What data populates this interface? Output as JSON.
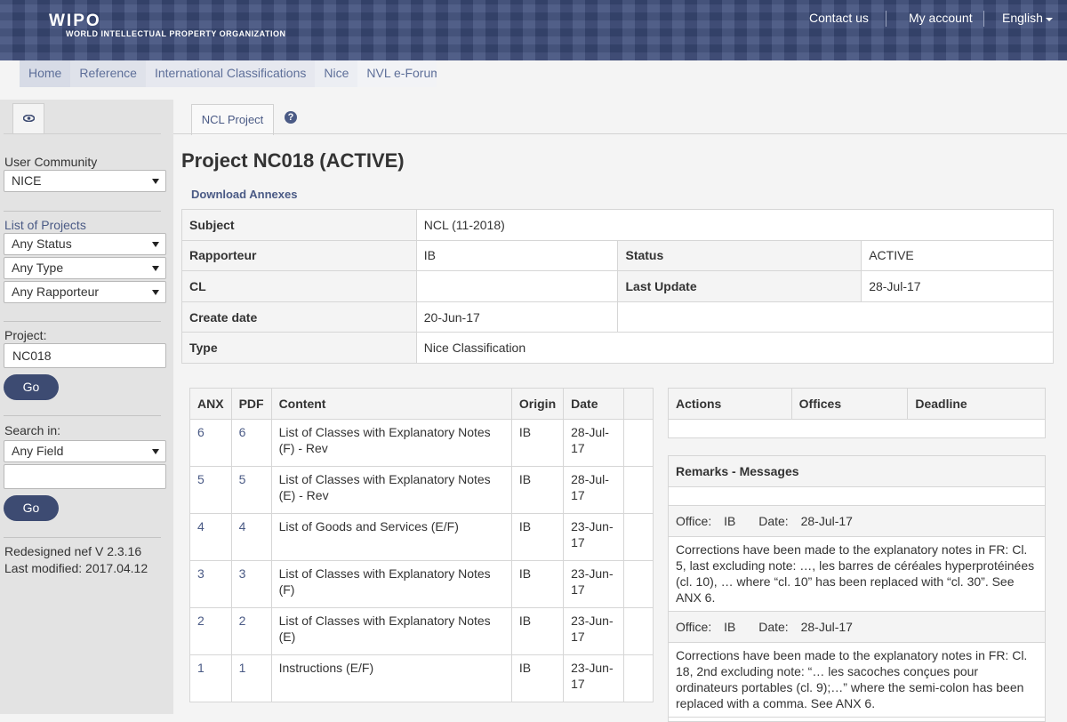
{
  "header": {
    "logo_main": "WIPO",
    "logo_sub": "WORLD INTELLECTUAL PROPERTY ORGANIZATION",
    "links": {
      "contact": "Contact us",
      "account": "My account",
      "language": "English"
    }
  },
  "breadcrumb": [
    "Home",
    "Reference",
    "International Classifications",
    "Nice",
    "NVL e-Forum"
  ],
  "sidebar": {
    "user_community_label": "User Community",
    "user_community_value": "NICE",
    "projects_label": "List of Projects",
    "status_value": "Any Status",
    "type_value": "Any Type",
    "rapporteur_value": "Any Rapporteur",
    "project_label": "Project:",
    "project_value": "NC018",
    "go_label": "Go",
    "search_label": "Search in:",
    "search_field_value": "Any Field",
    "search_text_value": "",
    "version": "Redesigned nef V 2.3.16",
    "modified": "Last modified: 2017.04.12"
  },
  "tabs": {
    "ncl_project": "NCL Project",
    "help": "?"
  },
  "main": {
    "title": "Project NC018 (ACTIVE)",
    "download": "Download Annexes",
    "info": {
      "subject_label": "Subject",
      "subject_value": "NCL (11-2018)",
      "rapporteur_label": "Rapporteur",
      "rapporteur_value": "IB",
      "status_label": "Status",
      "status_value": "ACTIVE",
      "cl_label": "CL",
      "cl_value": "",
      "lastupdate_label": "Last Update",
      "lastupdate_value": "28-Jul-17",
      "create_label": "Create date",
      "create_value": "20-Jun-17",
      "type_label": "Type",
      "type_value": "Nice Classification"
    },
    "annexes": {
      "headers": [
        "ANX",
        "PDF",
        "Content",
        "Origin",
        "Date"
      ],
      "rows": [
        {
          "anx": "6",
          "pdf": "6",
          "content": "List of Classes with Explanatory Notes (F) - Rev",
          "origin": "IB",
          "date": "28-Jul-17"
        },
        {
          "anx": "5",
          "pdf": "5",
          "content": "List of Classes with Explanatory Notes (E) - Rev",
          "origin": "IB",
          "date": "28-Jul-17"
        },
        {
          "anx": "4",
          "pdf": "4",
          "content": "List of Goods and Services (E/F)",
          "origin": "IB",
          "date": "23-Jun-17"
        },
        {
          "anx": "3",
          "pdf": "3",
          "content": "List of Classes with Explanatory Notes (F)",
          "origin": "IB",
          "date": "23-Jun-17"
        },
        {
          "anx": "2",
          "pdf": "2",
          "content": "List of Classes with Explanatory Notes (E)",
          "origin": "IB",
          "date": "23-Jun-17"
        },
        {
          "anx": "1",
          "pdf": "1",
          "content": "Instructions (E/F)",
          "origin": "IB",
          "date": "23-Jun-17"
        }
      ]
    },
    "actions": {
      "headers": [
        "Actions",
        "Offices",
        "Deadline"
      ]
    },
    "remarks": {
      "title": "Remarks - Messages",
      "office_label": "Office:",
      "date_label": "Date:",
      "items": [
        {
          "office": "IB",
          "date": "28-Jul-17",
          "text": "Corrections have been made to the explanatory notes in FR: Cl. 5, last excluding note: …, les barres de céréales hyperprotéinées (cl. 10), … where “cl. 10” has been replaced with “cl. 30”. See ANX 6."
        },
        {
          "office": "IB",
          "date": "28-Jul-17",
          "text": "Corrections have been made to the explanatory notes in FR: Cl. 18, 2nd excluding note: “… les sacoches conçues pour ordinateurs portables (cl. 9);…” where the semi-colon has been replaced with a comma. See ANX 6."
        }
      ]
    }
  }
}
